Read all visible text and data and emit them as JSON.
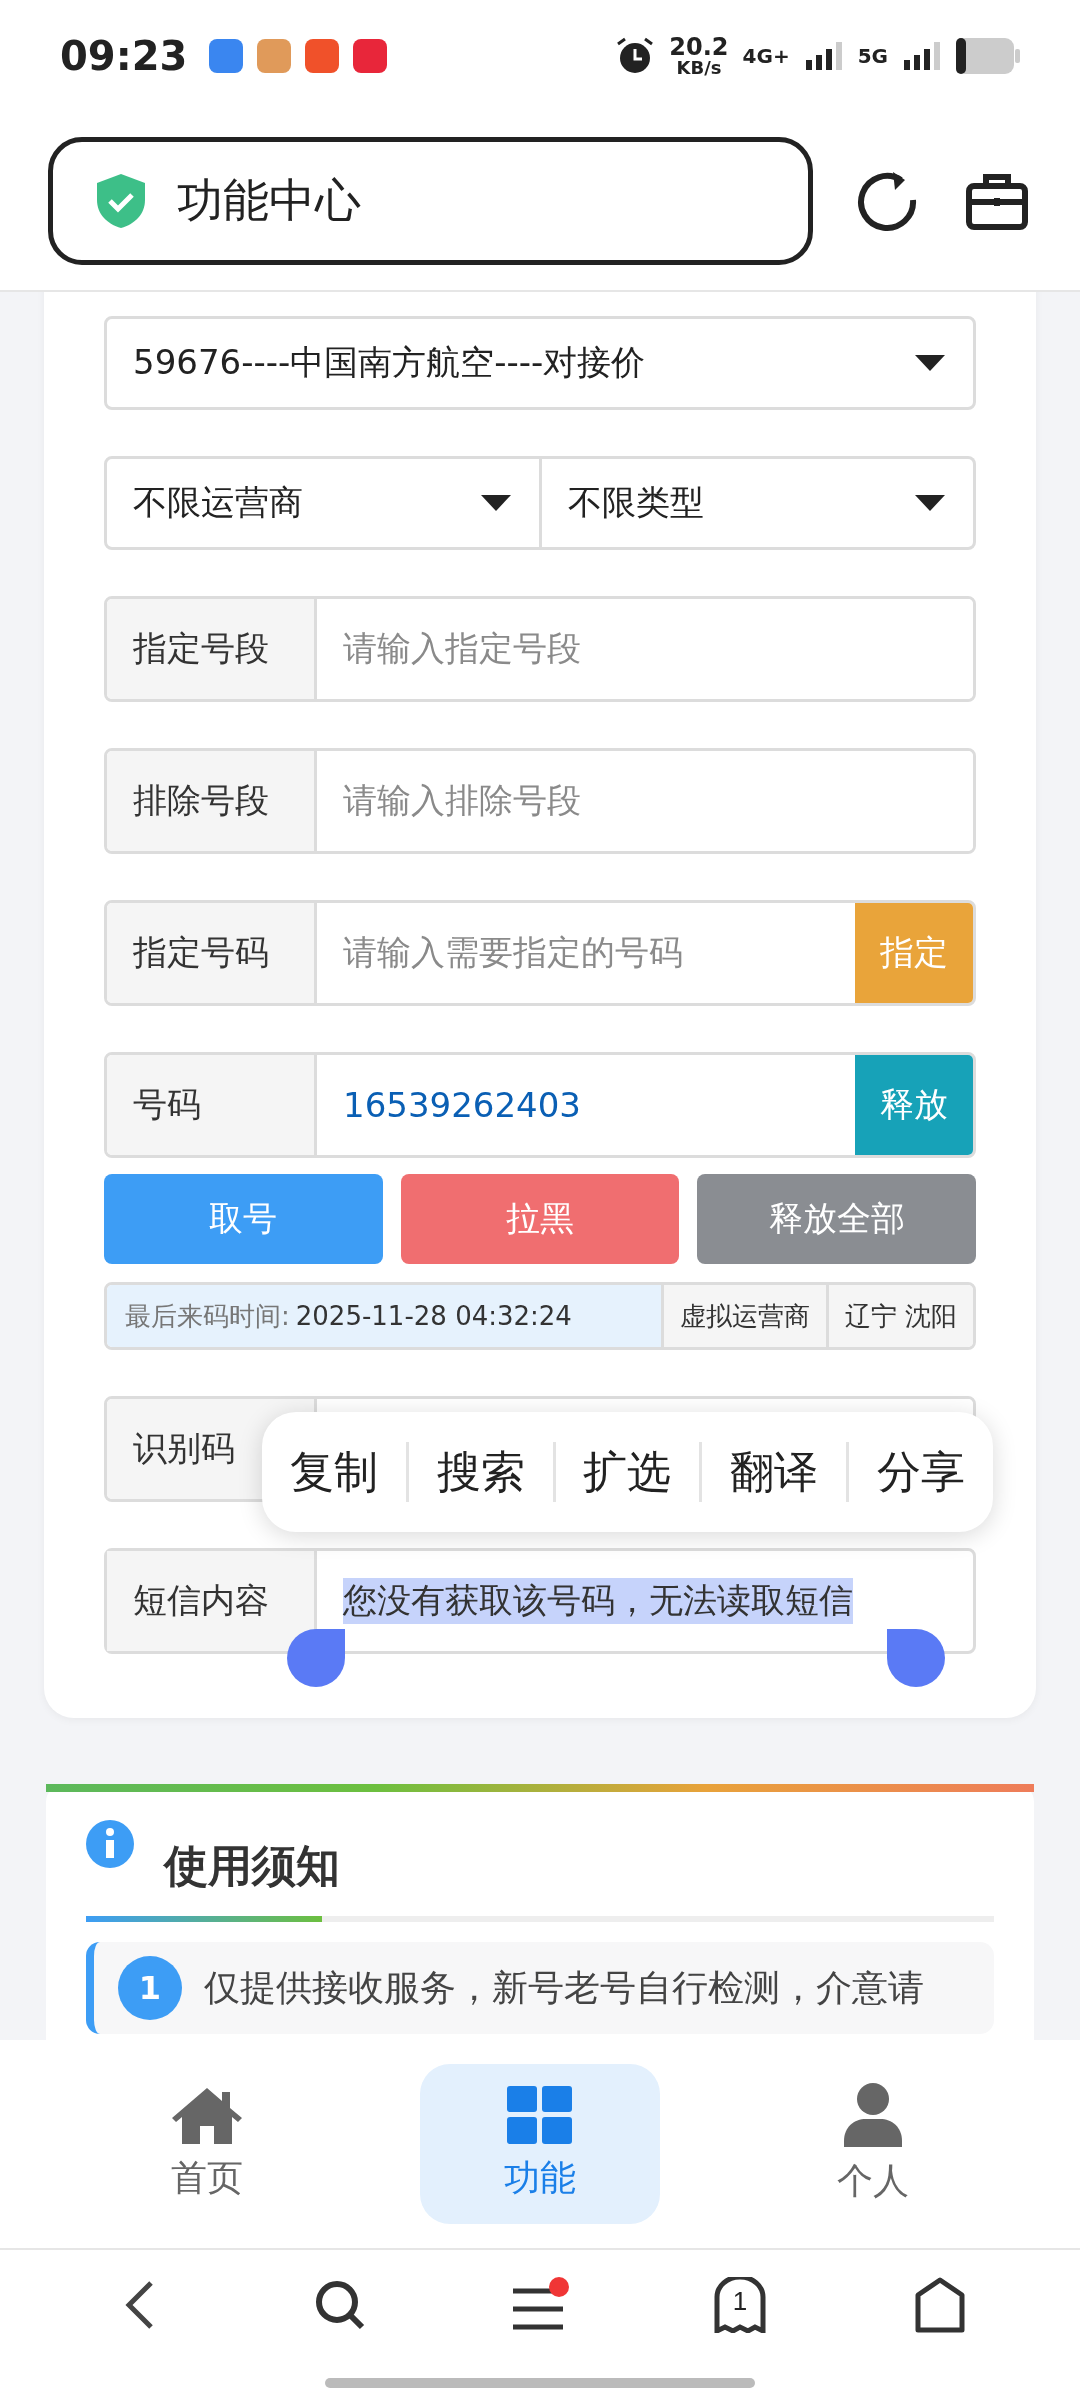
{
  "status_bar": {
    "time": "09:23",
    "net_speed": "20.2",
    "net_unit": "KB/s",
    "sim1": "4G+",
    "sim2": "5G"
  },
  "header": {
    "title": "功能中心"
  },
  "form": {
    "project": {
      "value": "59676----中国南方航空----对接价"
    },
    "carrier": {
      "value": "不限运营商"
    },
    "type": {
      "value": "不限类型"
    },
    "fields": [
      {
        "kind": "input",
        "label": "指定号段",
        "placeholder": "请输入指定号段"
      },
      {
        "kind": "input",
        "label": "排除号段",
        "placeholder": "请输入排除号段"
      },
      {
        "kind": "action",
        "label": "指定号码",
        "placeholder": "请输入需要指定的号码",
        "button": "指定",
        "color": "#e9a43a"
      },
      {
        "kind": "action",
        "label": "号码",
        "value": "16539262403",
        "button": "释放",
        "color": "#17a2b8"
      }
    ],
    "buttons": [
      {
        "label": "取号",
        "color": "#3d9df5"
      },
      {
        "label": "拉黑",
        "color": "#f06e70"
      },
      {
        "label": "释放全部",
        "color": "#8a8d92"
      }
    ],
    "info": {
      "label": "最后来码时间:",
      "time": "2025-11-28 04:32:24",
      "carrier": "虚拟运营商",
      "location": "辽宁 沈阳"
    },
    "code_field": {
      "label": "识别码"
    },
    "sms_field": {
      "label": "短信内容",
      "value": "您没有获取该号码，无法读取短信",
      "selected": true
    }
  },
  "context_menu": [
    "复制",
    "搜索",
    "扩选",
    "翻译",
    "分享"
  ],
  "notice": {
    "title": "使用须知",
    "items": [
      {
        "number": "1",
        "text": "仅提供接收服务，新号老号自行检测，介意请"
      }
    ]
  },
  "bottom_nav": [
    {
      "label": "首页",
      "selected": false
    },
    {
      "label": "功能",
      "selected": true
    },
    {
      "label": "个人",
      "selected": false
    }
  ],
  "browser_bar": {
    "tab_count": "1"
  }
}
